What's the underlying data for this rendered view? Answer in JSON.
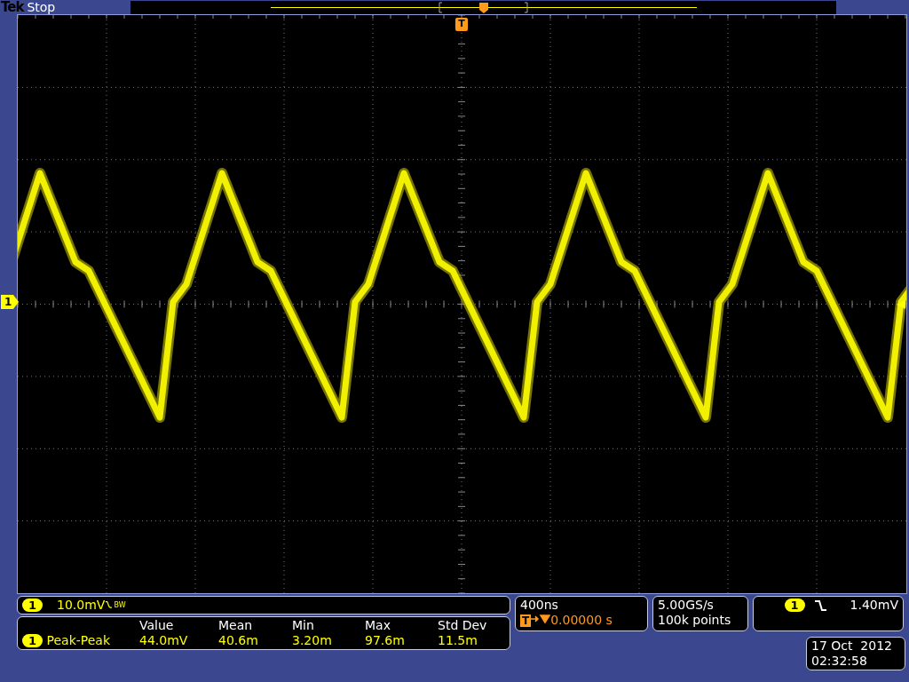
{
  "status_bar": {
    "brand": "Tek",
    "acquisition": "Stop"
  },
  "trigger_marker": "T",
  "channel_marker": "1",
  "channel": {
    "number": "1",
    "scale": "10.0mV",
    "bandwidth_mark": "BW"
  },
  "measurements": {
    "columns": [
      "Value",
      "Mean",
      "Min",
      "Max",
      "Std Dev"
    ],
    "rows": [
      {
        "channel": "1",
        "name": "Peak-Peak",
        "values": [
          "44.0mV",
          "40.6m",
          "3.20m",
          "97.6m",
          "11.5m"
        ]
      }
    ]
  },
  "horizontal": {
    "scale": "400ns",
    "position_label": "T",
    "position": "0.00000 s"
  },
  "acquisition": {
    "sample_rate": "5.00GS/s",
    "record_length": "100k points"
  },
  "trigger": {
    "source": "1",
    "falling_slope": true,
    "level": "1.40mV"
  },
  "date": {
    "day": "17 Oct  2012",
    "time": "02:32:58"
  }
}
